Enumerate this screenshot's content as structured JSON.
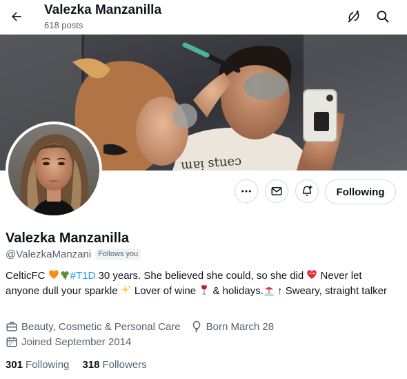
{
  "header": {
    "title": "Valezka Manzanilla",
    "posts_count": "618 posts",
    "icons": [
      "back-arrow-icon",
      "hide-repost-icon",
      "search-icon"
    ]
  },
  "profile": {
    "display_name": "Valezka Manzanilla",
    "handle": "@ValezkaManzani",
    "follows_you": "Follows you",
    "bio": {
      "part1": "CelticFC ",
      "hashtag": "#T1D",
      "part2": " 30 years. She believed she could, so she did ",
      "part3": " Never let anyone dull your sparkle ",
      "part4": " Lover of wine ",
      "part5": " & holidays.",
      "part6": " ↑ Sweary, straight talker"
    },
    "category": "Beauty, Cosmetic & Personal Care",
    "born": "Born March 28",
    "joined": "Joined September 2014",
    "following_count": "301",
    "following_label": "Following",
    "followers_count": "318",
    "followers_label": "Followers"
  },
  "actions": {
    "following_button": "Following",
    "icons": [
      "more-icon",
      "message-icon",
      "notification-bell-icon"
    ]
  },
  "colors": {
    "accent": "#1d9bf0",
    "secondary_text": "#536471",
    "border": "#cfd9de"
  }
}
